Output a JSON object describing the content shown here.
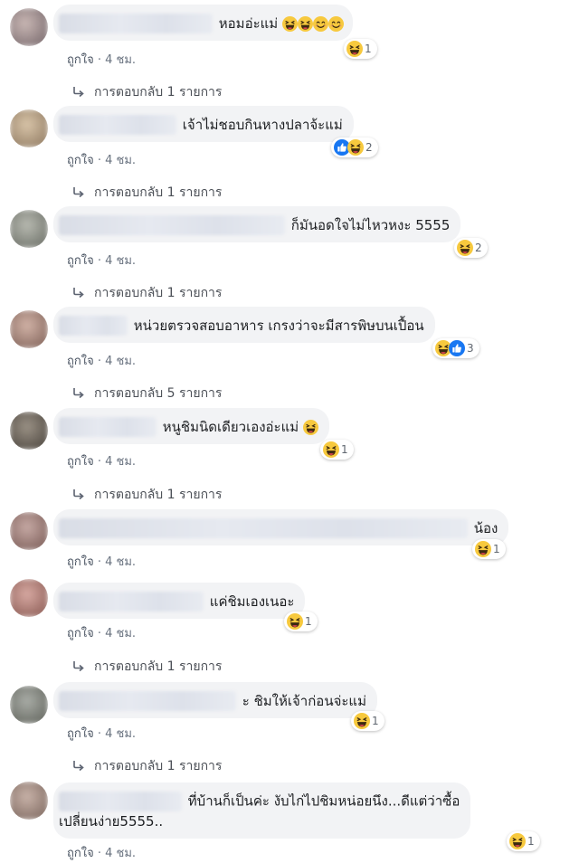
{
  "comments": [
    {
      "text": "หอมอ่ะแม่",
      "time": "4 ชม.",
      "like": "ถูกใจ",
      "reaction_count": "1",
      "reply": "การตอบกลับ 1 รายการ"
    },
    {
      "text": "เจ้าไม่ชอบกินหางปลาจ้ะแม่",
      "time": "4 ชม.",
      "like": "ถูกใจ",
      "reaction_count": "2",
      "reply": "การตอบกลับ 1 รายการ"
    },
    {
      "text": "ก็มันอดใจไม่ไหวหงะ 5555",
      "time": "4 ชม.",
      "like": "ถูกใจ",
      "reaction_count": "2",
      "reply": "การตอบกลับ 1 รายการ"
    },
    {
      "text": "หน่วยตรวจสอบอาหาร เกรงว่าจะมีสารพิษบนเปื้อน",
      "time": "4 ชม.",
      "like": "ถูกใจ",
      "reaction_count": "3",
      "reply": "การตอบกลับ 5 รายการ"
    },
    {
      "text": "หนูชิมนิดเดียวเองอ่ะแม่",
      "time": "4 ชม.",
      "like": "ถูกใจ",
      "reaction_count": "1",
      "reply": "การตอบกลับ 1 รายการ"
    },
    {
      "text": "น้อง",
      "time": "4 ชม.",
      "like": "ถูกใจ",
      "reaction_count": "1"
    },
    {
      "text": "แค่ชิมเองเนอะ",
      "time": "4 ชม.",
      "like": "ถูกใจ",
      "reaction_count": "1",
      "reply": "การตอบกลับ 1 รายการ"
    },
    {
      "text": "ะ ชิมให้เจ้าก่อนจ่ะแม่",
      "time": "4 ชม.",
      "like": "ถูกใจ",
      "reaction_count": "1",
      "reply": "การตอบกลับ 1 รายการ"
    },
    {
      "text_line1": "ที่บ้านก็เป็นค่ะ งับไก่ไปชิมหน่อยนึง...ดีแต่ว่าซื้อ",
      "text_line2": "เปลี่ยนง่าย5555..",
      "time": "4 ชม.",
      "like": "ถูกใจ",
      "reaction_count": "1"
    }
  ],
  "separator": " · ",
  "icons": {
    "haha": "haha-emoji-icon",
    "smile": "smile-emoji-icon",
    "like": "like-reaction-icon",
    "reply_arrow": "reply-arrow-icon"
  },
  "colors": {
    "bubble": "#f2f3f5",
    "meta": "#6a7380",
    "like_blue": "#1877f2",
    "emoji_yellow": "#f7c93e"
  }
}
